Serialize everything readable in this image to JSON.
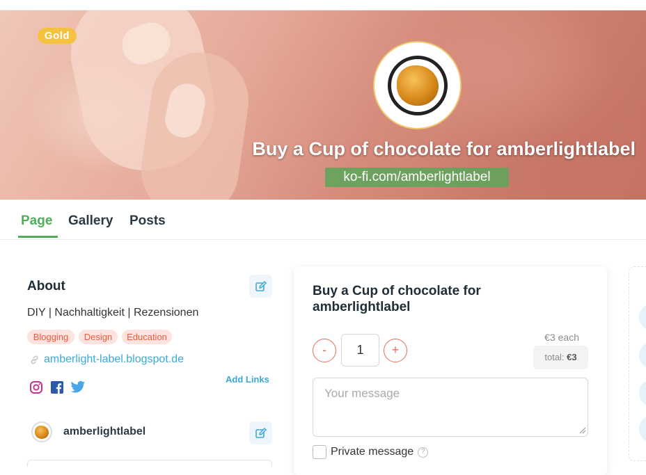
{
  "banner": {
    "badge": "Gold",
    "title": "Buy a Cup of chocolate for amberlightlabel",
    "url": "ko-fi.com/amberlightlabel"
  },
  "tabs": [
    {
      "label": "Page",
      "active": true
    },
    {
      "label": "Gallery",
      "active": false
    },
    {
      "label": "Posts",
      "active": false
    }
  ],
  "about": {
    "title": "About",
    "description": "DIY | Nachhaltigkeit | Rezensionen",
    "tags": [
      "Blogging",
      "Design",
      "Education"
    ],
    "link": "amberlight-label.blogspot.de",
    "add_links": "Add Links",
    "socials": [
      "instagram-icon",
      "facebook-icon",
      "twitter-icon"
    ],
    "username": "amberlightlabel"
  },
  "purchase": {
    "title": "Buy a Cup of chocolate for amberlightlabel",
    "minus": "-",
    "plus": "+",
    "quantity": "1",
    "each": "€3 each",
    "total_label": "total:",
    "total_value": "€3",
    "message_placeholder": "Your message",
    "private_label": "Private message",
    "help": "?"
  },
  "colors": {
    "accent_green": "#4fae5a",
    "tag_text": "#ee5a3c",
    "tag_bg": "#fde3e0",
    "link_blue": "#3aa9d6",
    "qty_red": "#e86a5a",
    "badge_gold": "#f5c141"
  }
}
